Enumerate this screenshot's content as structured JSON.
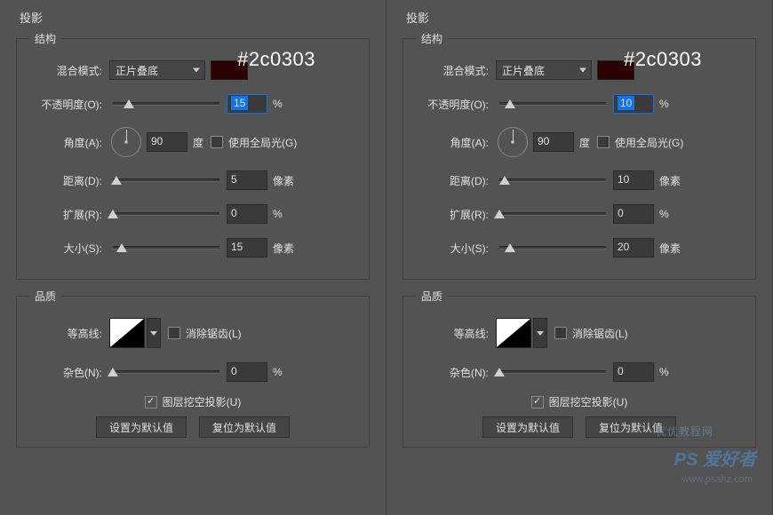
{
  "global": {
    "panel_title": "投影",
    "structure_legend": "结构",
    "quality_legend": "品质",
    "annotation": "#2c0303",
    "blend_mode_label": "混合模式:",
    "blend_mode_value": "正片叠底",
    "opacity_label": "不透明度(O):",
    "angle_label": "角度(A):",
    "angle_unit": "度",
    "global_light_label": "使用全局光(G)",
    "distance_label": "距离(D):",
    "spread_label": "扩展(R):",
    "size_label": "大小(S):",
    "percent_unit": "%",
    "pixel_unit": "像素",
    "contour_label": "等高线:",
    "antialias_label": "消除锯齿(L)",
    "noise_label": "杂色(N):",
    "knockout_label": "图层挖空投影(U)",
    "btn_default": "设置为默认值",
    "btn_reset": "复位为默认值",
    "swatch_color": "#2c0303"
  },
  "left": {
    "opacity": "15",
    "angle": "90",
    "distance": "5",
    "spread": "0",
    "size": "15",
    "noise": "0"
  },
  "right": {
    "opacity": "10",
    "angle": "90",
    "distance": "10",
    "spread": "0",
    "size": "20",
    "noise": "0"
  },
  "watermark": {
    "text1": "优优教程网",
    "text2": "PS 爱好者",
    "text3": "www.psahz.com"
  }
}
